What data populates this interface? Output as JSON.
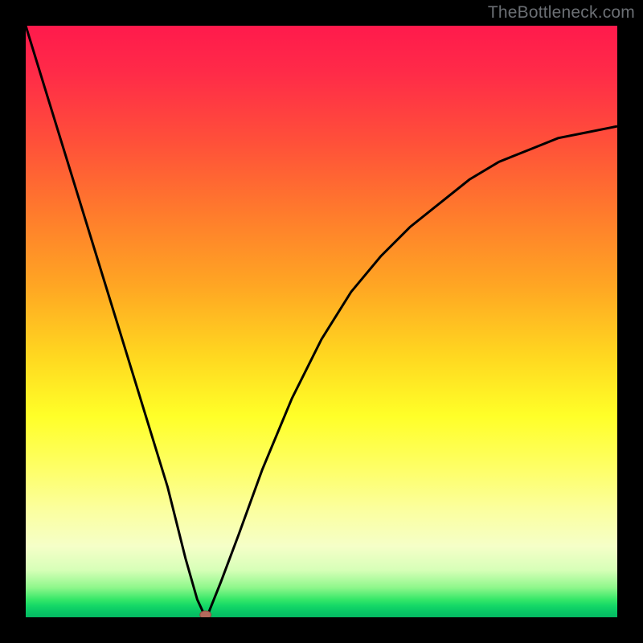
{
  "watermark": "TheBottleneck.com",
  "colors": {
    "curve": "#000000",
    "marker_fill": "#b56a5c",
    "frame": "#000000"
  },
  "chart_data": {
    "type": "line",
    "series": [
      {
        "name": "bottleneck-curve",
        "x": [
          0.0,
          0.04,
          0.08,
          0.12,
          0.16,
          0.2,
          0.24,
          0.27,
          0.29,
          0.304,
          0.31,
          0.33,
          0.36,
          0.4,
          0.45,
          0.5,
          0.55,
          0.6,
          0.65,
          0.7,
          0.75,
          0.8,
          0.85,
          0.9,
          0.95,
          1.0
        ],
        "y": [
          1.0,
          0.87,
          0.74,
          0.61,
          0.48,
          0.35,
          0.22,
          0.1,
          0.03,
          0.0,
          0.01,
          0.06,
          0.14,
          0.25,
          0.37,
          0.47,
          0.55,
          0.61,
          0.66,
          0.7,
          0.74,
          0.77,
          0.79,
          0.81,
          0.82,
          0.83
        ]
      }
    ],
    "min_marker": {
      "x": 0.304,
      "y": 0.0
    },
    "xlim": [
      0,
      1
    ],
    "ylim": [
      0,
      1
    ],
    "xlabel": "",
    "ylabel": "",
    "title": ""
  }
}
